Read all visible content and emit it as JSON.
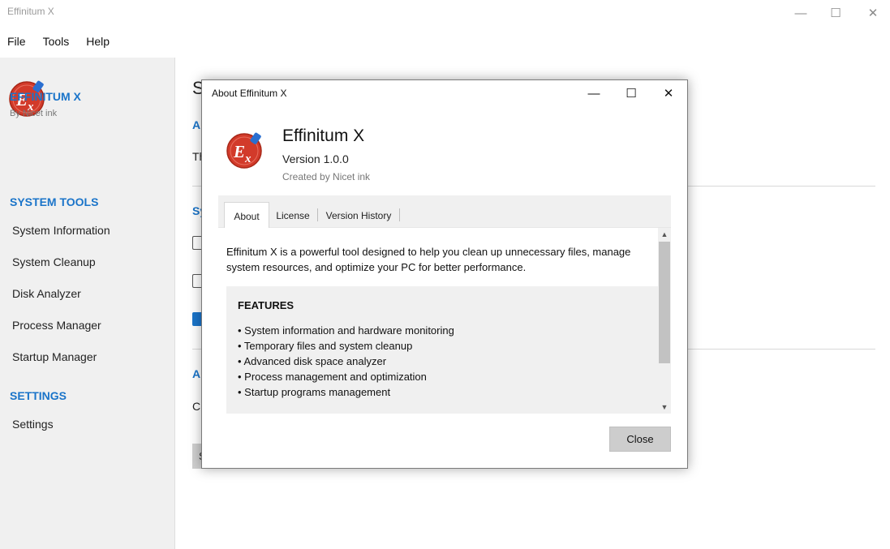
{
  "window": {
    "title": "Effinitum X",
    "minimize": "—",
    "maximize": "☐",
    "close": "✕"
  },
  "menubar": [
    "File",
    "Tools",
    "Help"
  ],
  "sidebar": {
    "app_name": "EFFINITUM X",
    "by_line": "By Nicet ink",
    "sections": [
      {
        "title": "SYSTEM TOOLS",
        "items": [
          "System Information",
          "System Cleanup",
          "Disk Analyzer",
          "Process Manager",
          "Startup Manager"
        ]
      },
      {
        "title": "SETTINGS",
        "items": [
          "Settings"
        ]
      }
    ]
  },
  "background_fragments": {
    "heading": "S",
    "label_a1": "A",
    "text_th": "Th",
    "label_sy": "Sy",
    "label_a2": "A",
    "text_cl": "Cl",
    "btn_s": "S"
  },
  "dialog": {
    "title": "About Effinitum X",
    "app_name": "Effinitum X",
    "version": "Version 1.0.0",
    "created_by": "Created by Nicet ink",
    "tabs": [
      "About",
      "License",
      "Version History"
    ],
    "active_tab": "About",
    "description_line1": "Effinitum X is a powerful tool designed to help you clean up unnecessary files, manage",
    "description_line2": "system resources, and optimize your PC for better performance.",
    "features_title": "FEATURES",
    "features": [
      "• System information and hardware monitoring",
      "• Temporary files and system cleanup",
      "• Advanced disk space analyzer",
      "• Process management and optimization",
      "• Startup programs management"
    ],
    "close_label": "Close"
  },
  "colors": {
    "accent": "#1a74c9",
    "logo_red": "#d23a2a",
    "logo_blue": "#2a6fd0"
  }
}
